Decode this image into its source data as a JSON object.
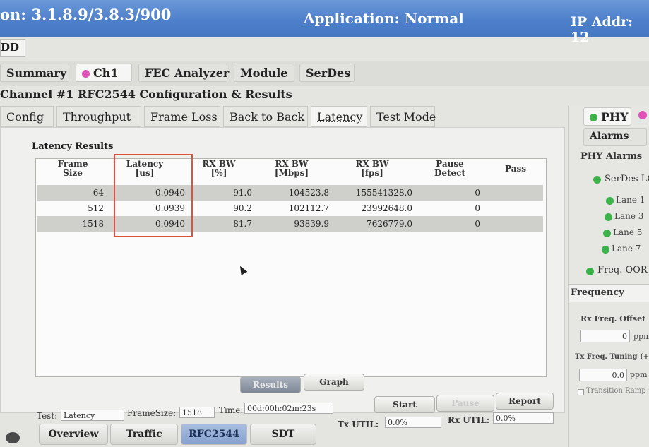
{
  "banner": {
    "version": "on: 3.1.8.9/3.8.3/900",
    "application": "Application: Normal",
    "ip": "IP Addr: 12"
  },
  "dd_tab": "DD",
  "top_tabs": [
    {
      "label": "Summary"
    },
    {
      "label": "Ch1",
      "icon": "pink-dot-icon"
    },
    {
      "label": "FEC Analyzer"
    },
    {
      "label": "Module"
    },
    {
      "label": "SerDes"
    }
  ],
  "channel_title": "Channel #1 RFC2544 Configuration & Results",
  "sub_tabs": [
    "Config",
    "Throughput",
    "Frame Loss",
    "Back to Back",
    "Latency",
    "Test Mode"
  ],
  "selected_sub_tab": "Latency",
  "results": {
    "title": "Latency Results",
    "headers": [
      [
        "Frame",
        "Size"
      ],
      [
        "Latency",
        "[us]"
      ],
      [
        "RX BW",
        "[%]"
      ],
      [
        "RX BW",
        "[Mbps]"
      ],
      [
        "RX BW",
        "[fps]"
      ],
      [
        "Pause",
        "Detect"
      ],
      [
        "Pass",
        ""
      ]
    ],
    "rows": [
      [
        "64",
        "0.0940",
        "91.0",
        "104523.8",
        "155541328.0",
        "0",
        ""
      ],
      [
        "512",
        "0.0939",
        "90.2",
        "102112.7",
        "23992648.0",
        "0",
        ""
      ],
      [
        "1518",
        "0.0940",
        "81.7",
        "93839.9",
        "7626779.0",
        "0",
        ""
      ]
    ]
  },
  "view_buttons": {
    "results": "Results",
    "graph": "Graph"
  },
  "status": {
    "test_label": "Test:",
    "test_value": "Latency",
    "framesize_label": "FrameSize:",
    "framesize_value": "1518",
    "time_label": "Time:",
    "time_value": "00d:00h:02m:23s"
  },
  "controls": {
    "start": "Start",
    "pause": "Pause",
    "report": "Report"
  },
  "util": {
    "tx_label": "Tx UTIL:",
    "tx_value": "0.0%",
    "rx_label": "Rx UTIL:",
    "rx_value": "0.0%"
  },
  "nav": [
    "Overview",
    "Traffic",
    "RFC2544",
    "SDT"
  ],
  "nav_selected": "RFC2544",
  "right_panel": {
    "phy": "PHY",
    "alarms": "Alarms",
    "phy_alarms": "PHY Alarms",
    "serdes": "SerDes LO",
    "lanes": [
      "Lane 1",
      "Lane 3",
      "Lane 5",
      "Lane 7"
    ],
    "freq_oor": "Freq. OOR (",
    "frequency": "Frequency",
    "rx_freq_offset": "Rx Freq. Offset",
    "rx_value": "0",
    "rx_unit": "ppm",
    "tx_freq_tuning": "Tx Freq. Tuning (+/-",
    "tx_value": "0.0",
    "tx_unit": "ppm",
    "transition": "Transition Ramp"
  },
  "colors": {
    "banner": "#4d7fca",
    "highlight": "#e0503c",
    "status_green": "#3cb34a",
    "channel_pink": "#e052b8"
  }
}
